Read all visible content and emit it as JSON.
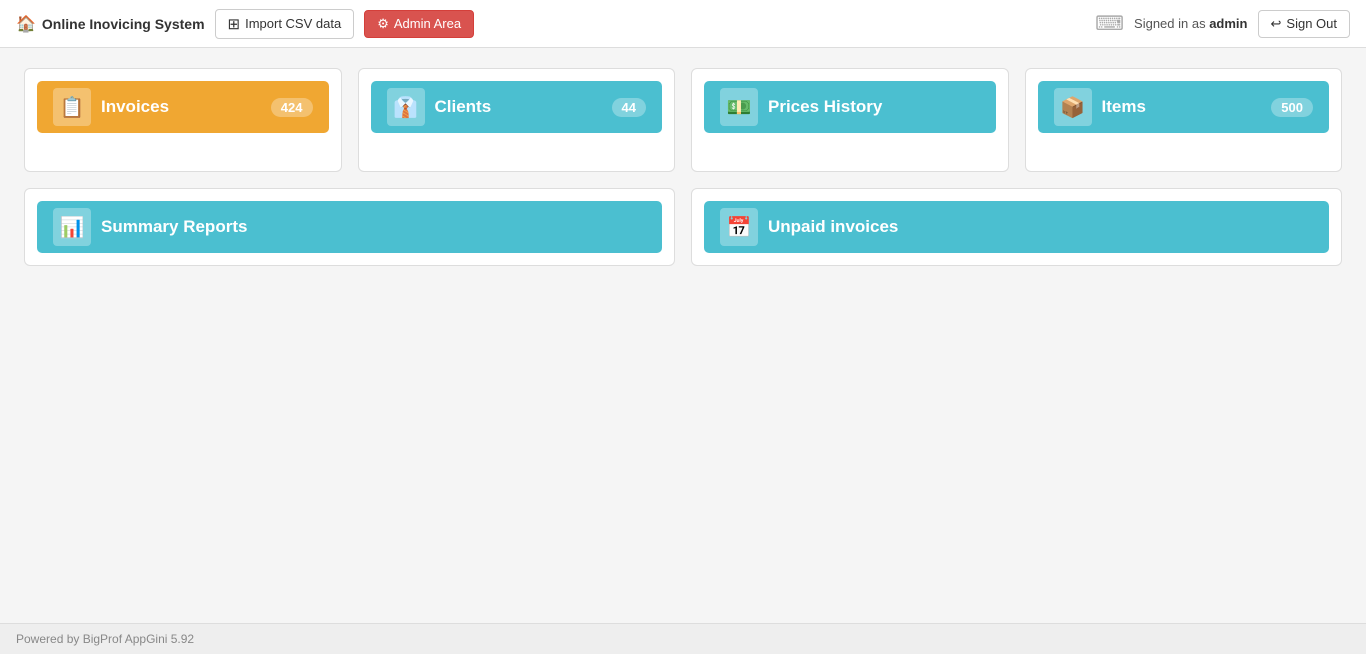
{
  "app": {
    "title": "Online Invoicing System",
    "footer": "Powered by BigProf AppGini 5.92"
  },
  "navbar": {
    "brand_label": "Online Inovicing System",
    "import_label": "Import CSV data",
    "admin_label": "Admin Area",
    "signed_in_prefix": "Signed in as ",
    "signed_in_user": "admin",
    "signout_label": "Sign Out"
  },
  "cards": {
    "invoices": {
      "label": "Invoices",
      "count": "424",
      "show_plus": true
    },
    "clients": {
      "label": "Clients",
      "count": "44",
      "show_plus": true
    },
    "prices_history": {
      "label": "Prices History",
      "show_plus": false
    },
    "items": {
      "label": "Items",
      "count": "500",
      "show_plus": true
    },
    "summary_reports": {
      "label": "Summary Reports"
    },
    "unpaid_invoices": {
      "label": "Unpaid invoices"
    }
  }
}
